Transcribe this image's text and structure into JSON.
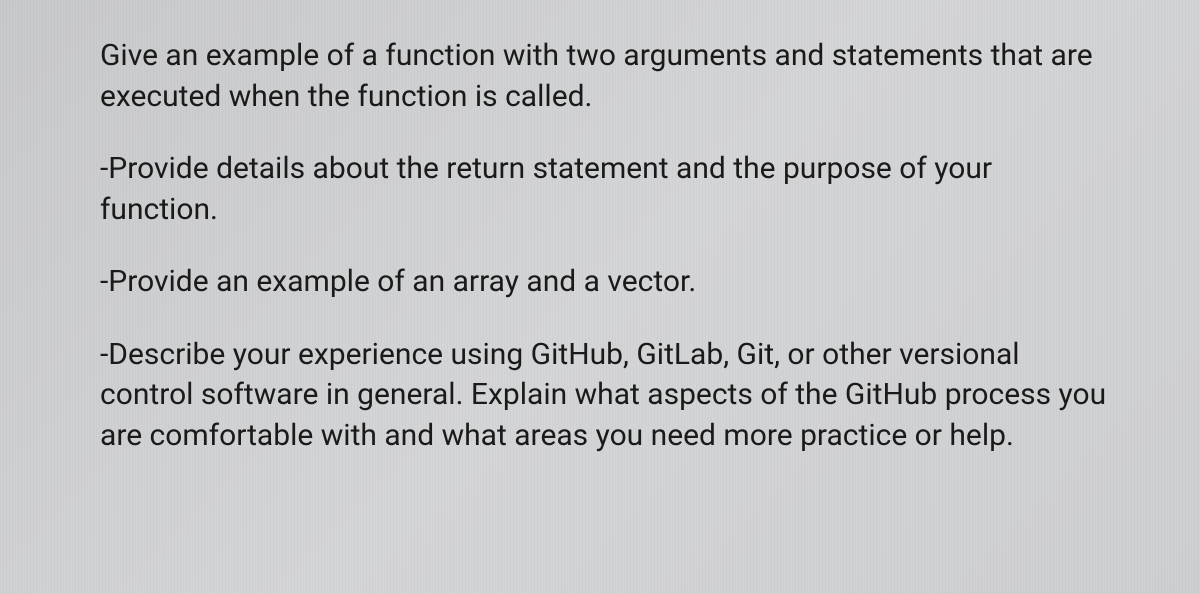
{
  "paragraphs": {
    "p1": "Give an example of a function with two arguments and statements that are executed when the function is called.",
    "p2": "-Provide details about the return statement and the purpose of your function.",
    "p3": "-Provide an example of an array and a vector.",
    "p4": "-Describe your experience using GitHub, GitLab, Git, or other versional control software in general. Explain what aspects of the GitHub process you are comfortable with and what areas you need more practice or help."
  }
}
